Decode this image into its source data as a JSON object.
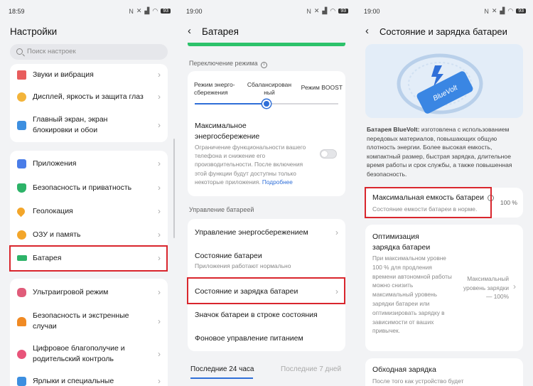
{
  "screen1": {
    "time": "18:59",
    "battery": "93",
    "title": "Настройки",
    "search_placeholder": "Поиск настроек",
    "group1": [
      "Звуки и вибрация",
      "Дисплей, яркость и защита глаз",
      "Главный экран, экран блокировки и обои"
    ],
    "group2": [
      "Приложения",
      "Безопасность и приватность",
      "Геолокация",
      "ОЗУ и память",
      "Батарея"
    ],
    "group3": [
      "Ультраигровой режим",
      "Безопасность и экстренные случаи",
      "Цифровое благополучие и родительский контроль",
      "Ярлыки и специальные"
    ],
    "colors": {
      "highlight": "#d9262d"
    }
  },
  "screen2": {
    "time": "19:00",
    "battery": "93",
    "title": "Батарея",
    "mode_section": "Переключение режима",
    "modes": [
      "Режим энерго-сбережения",
      "Сбалансирован ный",
      "Режим BOOST"
    ],
    "selected_mode": 1,
    "max_saving_title": "Максимальное энергосбережение",
    "max_saving_desc": "Ограничение функциональности вашего телефона и снижение его производительности. После включения этой функции будут доступны только некоторые приложения.",
    "more_link": "Подробнее",
    "mgmt_section": "Управление батареей",
    "energy_mgmt": "Управление энергосбережением",
    "battery_state": "Состояние батареи",
    "battery_state_sub": "Приложения работают нормально",
    "state_charging": "Состояние и зарядка батареи",
    "status_icon": "Значок батареи в строке состояния",
    "background": "Фоновое управление питанием",
    "tab_active": "Последние 24 часа",
    "tab_inactive": "Последние 7 дней"
  },
  "screen3": {
    "time": "19:00",
    "battery": "93",
    "title": "Состояние и зарядка батареи",
    "card_brand": "BlueVolt",
    "desc_bold": "Батарея BlueVolt:",
    "desc": "изготовлена с использованием передовых материалов, повышающих общую плотность энергии. Более высокая емкость, компактный размер, быстрая зарядка, длительное время работы и срок службы, а также повышенная безопасность.",
    "max_capacity": "Максимальная емкость батареи",
    "max_capacity_sub": "Состояние емкости батареи в норме.",
    "max_capacity_value": "100 %",
    "opt_title": "Оптимизация зарядка батареи",
    "opt_desc": "При максимальном уровне 100 % для продления времени автономной работы можно снизить максимальный уровень зарядки батареи или оптимизировать зарядку в зависимости от ваших привычек.",
    "opt_value": "Максимальный уровень зарядки — 100%",
    "bypass_title": "Обходная зарядка",
    "bypass_sub": "После того как устройство будет"
  }
}
